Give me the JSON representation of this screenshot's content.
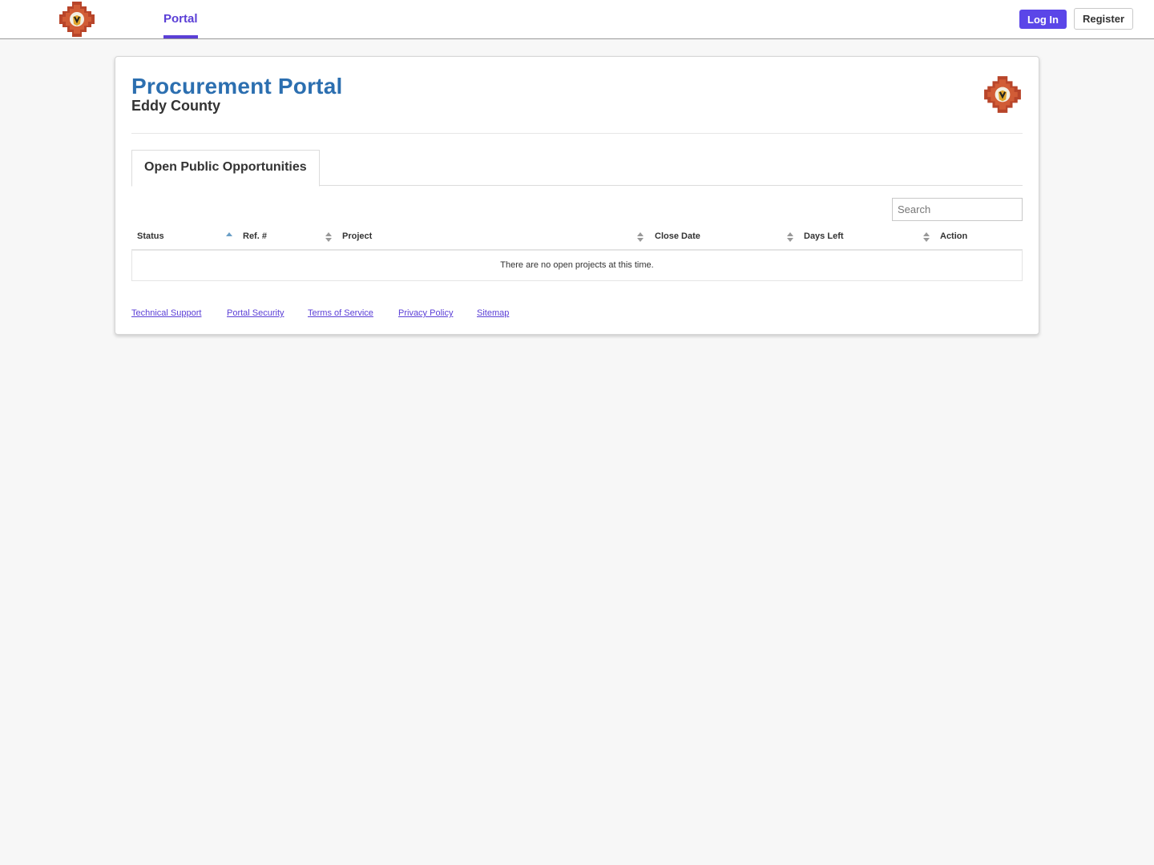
{
  "header": {
    "nav_tab": "Portal",
    "login_label": "Log In",
    "register_label": "Register"
  },
  "page": {
    "title": "Procurement Portal",
    "subtitle": "Eddy County",
    "tab_label": "Open Public Opportunities",
    "search_placeholder": "Search"
  },
  "table": {
    "columns": [
      "Status",
      "Ref. #",
      "Project",
      "Close Date",
      "Days Left",
      "Action"
    ],
    "empty_message": "There are no open projects at this time."
  },
  "footer": {
    "links": [
      "Technical Support",
      "Portal Security",
      "Terms of Service",
      "Privacy Policy",
      "Sitemap"
    ]
  },
  "colors": {
    "accent": "#5b3fd6",
    "title_blue": "#2c6fb0",
    "login_button": "#5b46e8"
  },
  "icons": {
    "logo": "county-seal-logo",
    "sort_asc": "sort-ascending-icon",
    "sort_both": "sort-both-icon"
  }
}
